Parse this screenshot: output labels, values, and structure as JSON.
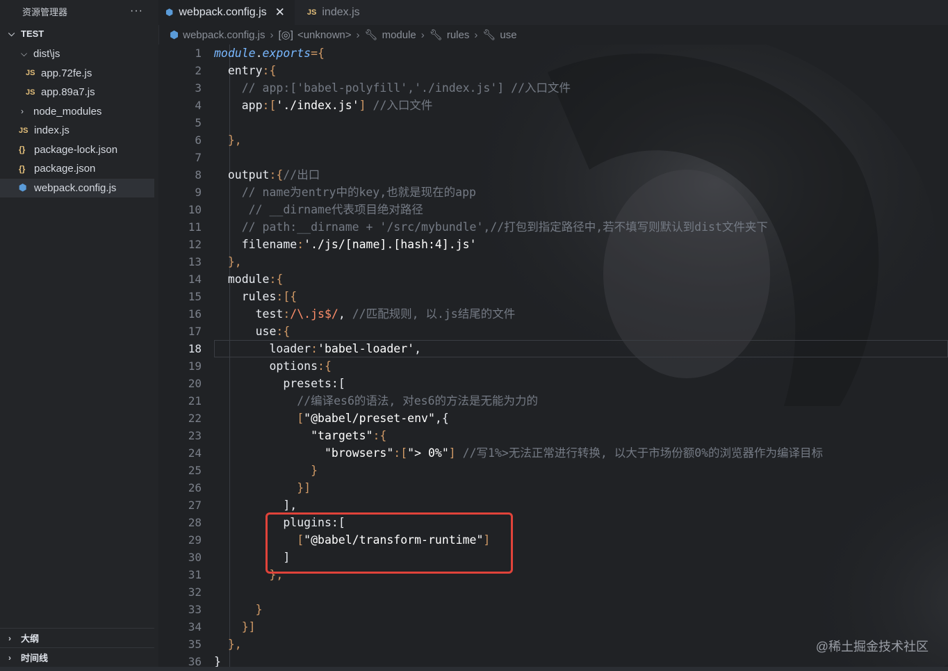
{
  "sidebar": {
    "title": "资源管理器",
    "more": "···",
    "project": "TEST",
    "items": [
      {
        "label": "dist\\js",
        "icon": "folder-open-icon",
        "chevron": "⌵"
      },
      {
        "label": "app.72fe.js",
        "icon": "js-file-icon",
        "icon_text": "JS"
      },
      {
        "label": "app.89a7.js",
        "icon": "js-file-icon",
        "icon_text": "JS"
      },
      {
        "label": "node_modules",
        "icon": "folder-closed-icon",
        "chevron": "›"
      },
      {
        "label": "index.js",
        "icon": "js-file-icon",
        "icon_text": "JS"
      },
      {
        "label": "package-lock.json",
        "icon": "json-file-icon",
        "icon_text": "{}"
      },
      {
        "label": "package.json",
        "icon": "json-file-icon",
        "icon_text": "{}"
      },
      {
        "label": "webpack.config.js",
        "icon": "webpack-file-icon",
        "icon_text": "⬢"
      }
    ],
    "outline": "大纲",
    "timeline": "时间线"
  },
  "tabs": [
    {
      "label": "webpack.config.js",
      "close": "✕"
    },
    {
      "label": "index.js",
      "icon_text": "JS"
    }
  ],
  "breadcrumb": {
    "file": "webpack.config.js",
    "unknown": "<unknown>",
    "module": "module",
    "rules": "rules",
    "use": "use"
  },
  "editor": {
    "current_line": 18,
    "line_numbers": [
      "1",
      "2",
      "3",
      "4",
      "5",
      "6",
      "7",
      "8",
      "9",
      "10",
      "11",
      "12",
      "13",
      "14",
      "15",
      "16",
      "17",
      "18",
      "19",
      "20",
      "21",
      "22",
      "23",
      "24",
      "25",
      "26",
      "27",
      "28",
      "29",
      "30",
      "31",
      "32",
      "33",
      "34",
      "35",
      "36"
    ],
    "lines": {
      "l1_a": "module",
      "l1_b": ".",
      "l1_c": "exports",
      "l1_d": "={",
      "l2_a": "  entry",
      "l2_b": ":{",
      "l3": "    // app:['babel-polyfill','./index.js'] //入口文件",
      "l4_a": "    app",
      "l4_b": ":[",
      "l4_c": "'./index.js'",
      "l4_d": "] ",
      "l4_e": "//入口文件",
      "l6": "  },",
      "l8_a": "  output",
      "l8_b": ":{",
      "l8_c": "//出口",
      "l9": "    // name为entry中的key,也就是现在的app",
      "l10": "     // __dirname代表项目绝对路径",
      "l11": "    // path:__dirname + '/src/mybundle',//打包到指定路径中,若不填写则默认到dist文件夹下",
      "l12_a": "    filename",
      "l12_b": ":",
      "l12_c": "'./js/[name].[hash:4].js'",
      "l13": "  },",
      "l14_a": "  module",
      "l14_b": ":{",
      "l15_a": "    rules",
      "l15_b": ":[{",
      "l16_a": "      test",
      "l16_b": ":",
      "l16_c": "/\\.js$/",
      "l16_d": ", ",
      "l16_e": "//匹配规则, 以.js结尾的文件",
      "l17_a": "      use",
      "l17_b": ":{",
      "l18_a": "        loader",
      "l18_b": ":",
      "l18_c": "'babel-loader'",
      "l18_d": ",",
      "l19_a": "        options",
      "l19_b": ":{",
      "l20_a": "          presets",
      "l20_b": ":[",
      "l21": "            //编译es6的语法, 对es6的方法是无能为力的",
      "l22_a": "            [",
      "l22_b": "\"@babel/preset-env\"",
      "l22_c": ",{",
      "l23_a": "              ",
      "l23_b": "\"targets\"",
      "l23_c": ":{",
      "l24_a": "                ",
      "l24_b": "\"browsers\"",
      "l24_c": ":[",
      "l24_d": "\"> 0%\"",
      "l24_e": "] ",
      "l24_f": "//写1%>无法正常进行转换, 以大于市场份额0%的浏览器作为编译目标",
      "l25": "              }",
      "l26": "            }]",
      "l27": "          ],",
      "l28_a": "          plugins",
      "l28_b": ":[",
      "l29_a": "            [",
      "l29_b": "\"@babel/transform-runtime\"",
      "l29_c": "]",
      "l30": "          ]",
      "l31": "        },",
      "l33": "      }",
      "l34": "    }]",
      "l35": "  },",
      "l36": "}"
    }
  },
  "watermark": "@稀土掘金技术社区",
  "colors": {
    "highlight_box": "#e0433a",
    "keyword_orange": "#d19a66",
    "comment": "#747a84"
  }
}
